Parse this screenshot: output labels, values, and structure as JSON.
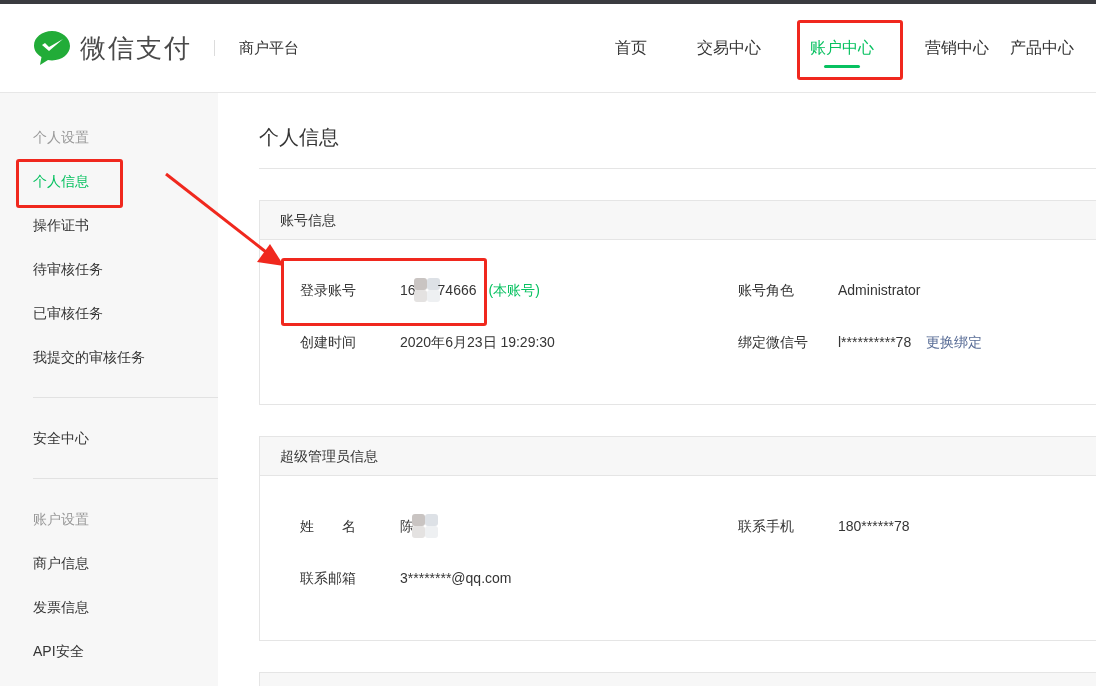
{
  "header": {
    "logo_text": "微信支付",
    "platform_name": "商户平台",
    "nav": [
      {
        "label": "首页",
        "selected": false
      },
      {
        "label": "交易中心",
        "selected": false
      },
      {
        "label": "账户中心",
        "selected": true,
        "highlighted": true
      },
      {
        "label": "营销中心",
        "selected": false
      },
      {
        "label": "产品中心",
        "selected": false
      }
    ]
  },
  "sidebar": {
    "sections": [
      {
        "heading": "个人设置",
        "items": [
          {
            "label": "个人信息",
            "selected": true,
            "highlighted": true
          },
          {
            "label": "操作证书",
            "selected": false
          },
          {
            "label": "待审核任务",
            "selected": false
          },
          {
            "label": "已审核任务",
            "selected": false
          },
          {
            "label": "我提交的审核任务",
            "selected": false
          }
        ]
      },
      {
        "items": [
          {
            "label": "安全中心",
            "selected": false
          }
        ]
      },
      {
        "heading": "账户设置",
        "items": [
          {
            "label": "商户信息",
            "selected": false
          },
          {
            "label": "发票信息",
            "selected": false
          },
          {
            "label": "API安全",
            "selected": false
          }
        ]
      }
    ]
  },
  "content": {
    "title": "个人信息",
    "annotation_arrow": true,
    "panels": [
      {
        "title": "账号信息",
        "fields": [
          {
            "label": "登录账号",
            "value": "16",
            "redacted": true,
            "value_after": "74666",
            "note": "(本账号)",
            "highlighted": true
          },
          {
            "label": "账号角色",
            "value": "Administrator"
          },
          {
            "label": "创建时间",
            "value": "2020年6月23日 19:29:30"
          },
          {
            "label": "绑定微信号",
            "value": "l**********78",
            "link": "更换绑定"
          }
        ]
      },
      {
        "title": "超级管理员信息",
        "fields": [
          {
            "label": "姓　　名",
            "value": "陈",
            "redacted": true
          },
          {
            "label": "联系手机",
            "value": "180******78"
          },
          {
            "label": "联系邮箱",
            "value": "3********@qq.com"
          }
        ]
      }
    ]
  }
}
